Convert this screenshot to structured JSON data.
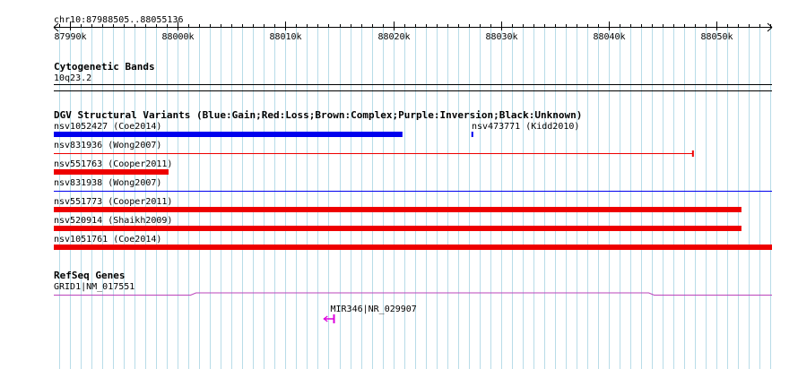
{
  "locus": "chr10:87988505..88055136",
  "ruler": {
    "ticks": [
      {
        "pos": 87990000,
        "label": "87990k"
      },
      {
        "pos": 88000000,
        "label": "88000k"
      },
      {
        "pos": 88010000,
        "label": "88010k"
      },
      {
        "pos": 88020000,
        "label": "88020k"
      },
      {
        "pos": 88030000,
        "label": "88030k"
      },
      {
        "pos": 88040000,
        "label": "88040k"
      },
      {
        "pos": 88050000,
        "label": "88050k"
      }
    ]
  },
  "cytoband": {
    "title": "Cytogenetic Bands",
    "band": "10q23.2"
  },
  "dgv": {
    "title": "DGV Structural Variants (Blue:Gain;Red:Loss;Brown:Complex;Purple:Inversion;Black:Unknown)",
    "colors": {
      "gain": "#0000ee",
      "loss": "#ee0000",
      "complex": "#8b4513",
      "inversion": "#800080",
      "unknown": "#000000"
    },
    "features": [
      {
        "name": "nsv1052427 (Coe2014)",
        "start": 87988505,
        "end": 88020850,
        "type": "gain",
        "style": "thick",
        "row": 0
      },
      {
        "name": "nsv473771 (Kidd2010)",
        "start": 88027250,
        "end": 88027400,
        "type": "gain",
        "style": "thick",
        "row": 0
      },
      {
        "name": "nsv831936 (Wong2007)",
        "start": 87988505,
        "end": 88047800,
        "type": "loss",
        "style": "thin",
        "row": 1
      },
      {
        "name": "nsv551763 (Cooper2011)",
        "start": 87988505,
        "end": 87999150,
        "type": "loss",
        "style": "thick",
        "row": 2
      },
      {
        "name": "nsv831938 (Wong2007)",
        "start": 87988505,
        "end": 88055136,
        "type": "gain",
        "style": "thin",
        "row": 3
      },
      {
        "name": "nsv551773 (Cooper2011)",
        "start": 87988505,
        "end": 88052300,
        "type": "loss",
        "style": "thick",
        "row": 4
      },
      {
        "name": "nsv520914 (Shaikh2009)",
        "start": 87988505,
        "end": 88052300,
        "type": "loss",
        "style": "thick",
        "row": 5
      },
      {
        "name": "nsv1051761 (Coe2014)",
        "start": 87988505,
        "end": 88055136,
        "type": "loss",
        "style": "thick",
        "row": 6
      }
    ]
  },
  "refseq": {
    "title": "RefSeq Genes",
    "genes": [
      {
        "name": "GRID1|NM_017551",
        "start": 87988505,
        "end": 88055136,
        "color": "#bb44bb"
      },
      {
        "name": "MIR346|NR_029907",
        "start": 88014150,
        "end": 88014500,
        "color": "#dd00dd",
        "strand": "-"
      }
    ]
  }
}
